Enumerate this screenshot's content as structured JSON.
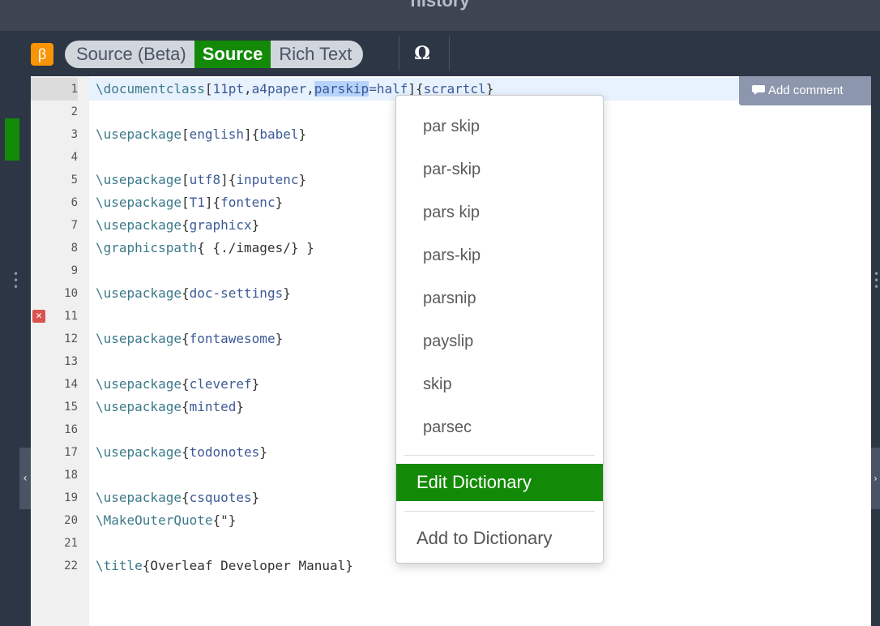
{
  "window": {
    "title": "history"
  },
  "toolbar": {
    "beta_badge": "β",
    "modes": [
      "Source (Beta)",
      "Source",
      "Rich Text"
    ],
    "active_mode": "Source",
    "omega": "Ω"
  },
  "editor": {
    "add_comment": "Add comment",
    "active_line": 1,
    "error_line": 11,
    "line_numbers": [
      "1",
      "2",
      "3",
      "4",
      "5",
      "6",
      "7",
      "8",
      "9",
      "10",
      "11",
      "12",
      "13",
      "14",
      "15",
      "16",
      "17",
      "18",
      "19",
      "20",
      "21",
      "22"
    ],
    "lines": {
      "l1": {
        "a": "\\documentclass",
        "b": "[",
        "c": "11pt",
        "d": ",",
        "e": "a4paper",
        "f": ",",
        "sel": "parskip",
        "g": "=half",
        "h": "]{",
        "i": "scrartcl",
        "j": "}"
      },
      "l3": {
        "a": "\\usepackage",
        "b": "[",
        "c": "english",
        "d": "]{",
        "e": "babel",
        "f": "}"
      },
      "l5": {
        "a": "\\usepackage",
        "b": "[",
        "c": "utf8",
        "d": "]{",
        "e": "inputenc",
        "f": "}"
      },
      "l6": {
        "a": "\\usepackage",
        "b": "[",
        "c": "T1",
        "d": "]{",
        "e": "fontenc",
        "f": "}"
      },
      "l7": {
        "a": "\\usepackage",
        "b": "{",
        "c": "graphicx",
        "d": "}"
      },
      "l8": {
        "a": "\\graphicspath",
        "b": "{ {./images/} }"
      },
      "l10": {
        "a": "\\usepackage",
        "b": "{",
        "c": "doc-settings",
        "d": "}"
      },
      "l12": {
        "a": "\\usepackage",
        "b": "{",
        "c": "fontawesome",
        "d": "}"
      },
      "l14": {
        "a": "\\usepackage",
        "b": "{",
        "c": "cleveref",
        "d": "}"
      },
      "l15": {
        "a": "\\usepackage",
        "b": "{",
        "c": "minted",
        "d": "}"
      },
      "l17": {
        "a": "\\usepackage",
        "b": "{",
        "c": "todonotes",
        "d": "}"
      },
      "l19": {
        "a": "\\usepackage",
        "b": "{",
        "c": "csquotes",
        "d": "}"
      },
      "l20": {
        "a": "\\MakeOuterQuote",
        "b": "{\"}"
      },
      "l22": {
        "a": "\\title",
        "b": "{Overleaf Developer Manual}"
      }
    }
  },
  "spell_menu": {
    "suggestions": [
      "par skip",
      "par-skip",
      "pars kip",
      "pars-kip",
      "parsnip",
      "payslip",
      "skip",
      "parsec"
    ],
    "edit_dictionary": "Edit Dictionary",
    "add_to_dictionary": "Add to Dictionary"
  },
  "colors": {
    "accent_green": "#138a07",
    "beta_orange": "#f89406",
    "error_red": "#d9534f"
  }
}
